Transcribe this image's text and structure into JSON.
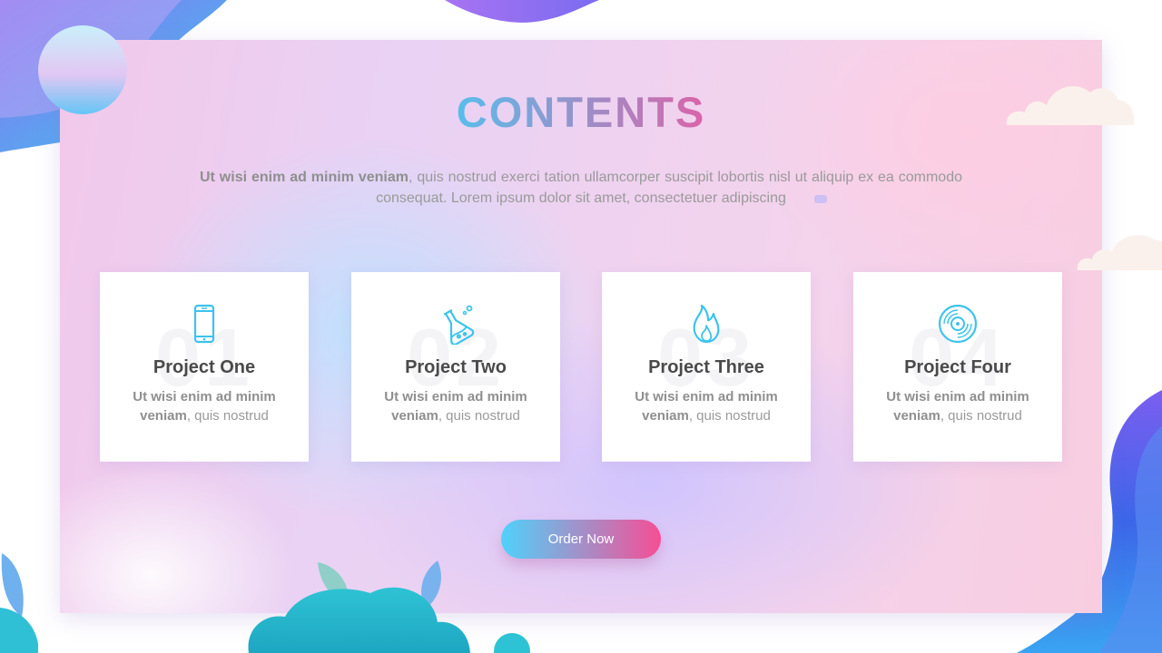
{
  "slide": {
    "title": "CONTENTS",
    "intro": {
      "bold": "Ut wisi enim ad minim veniam",
      "text": ", quis nostrud exerci tation ullamcorper suscipit lobortis nisl ut aliquip ex ea commodo consequat. Lorem ipsum dolor sit amet, consectetuer adipiscing"
    },
    "cards": [
      {
        "number": "01",
        "icon": "smartphone-icon",
        "title": "Project One",
        "desc_bold1": "Ut wisi enim ad minim",
        "desc_bold2": "veniam",
        "desc_rest": ", quis nostrud"
      },
      {
        "number": "02",
        "icon": "lab-flask-icon",
        "title": "Project Two",
        "desc_bold1": "Ut wisi enim ad minim",
        "desc_bold2": "veniam",
        "desc_rest": ", quis nostrud"
      },
      {
        "number": "03",
        "icon": "flame-icon",
        "title": "Project Three",
        "desc_bold1": "Ut wisi enim ad minim",
        "desc_bold2": "veniam",
        "desc_rest": ", quis nostrud"
      },
      {
        "number": "04",
        "icon": "disc-icon",
        "title": "Project Four",
        "desc_bold1": "Ut wisi enim ad minim",
        "desc_bold2": "veniam",
        "desc_rest": ", quis nostrud"
      }
    ],
    "button": {
      "label": "Order Now"
    },
    "colors": {
      "accent_blue": "#3fd0f8",
      "accent_pink": "#f4519a",
      "icon": "#3cc3ee"
    }
  }
}
